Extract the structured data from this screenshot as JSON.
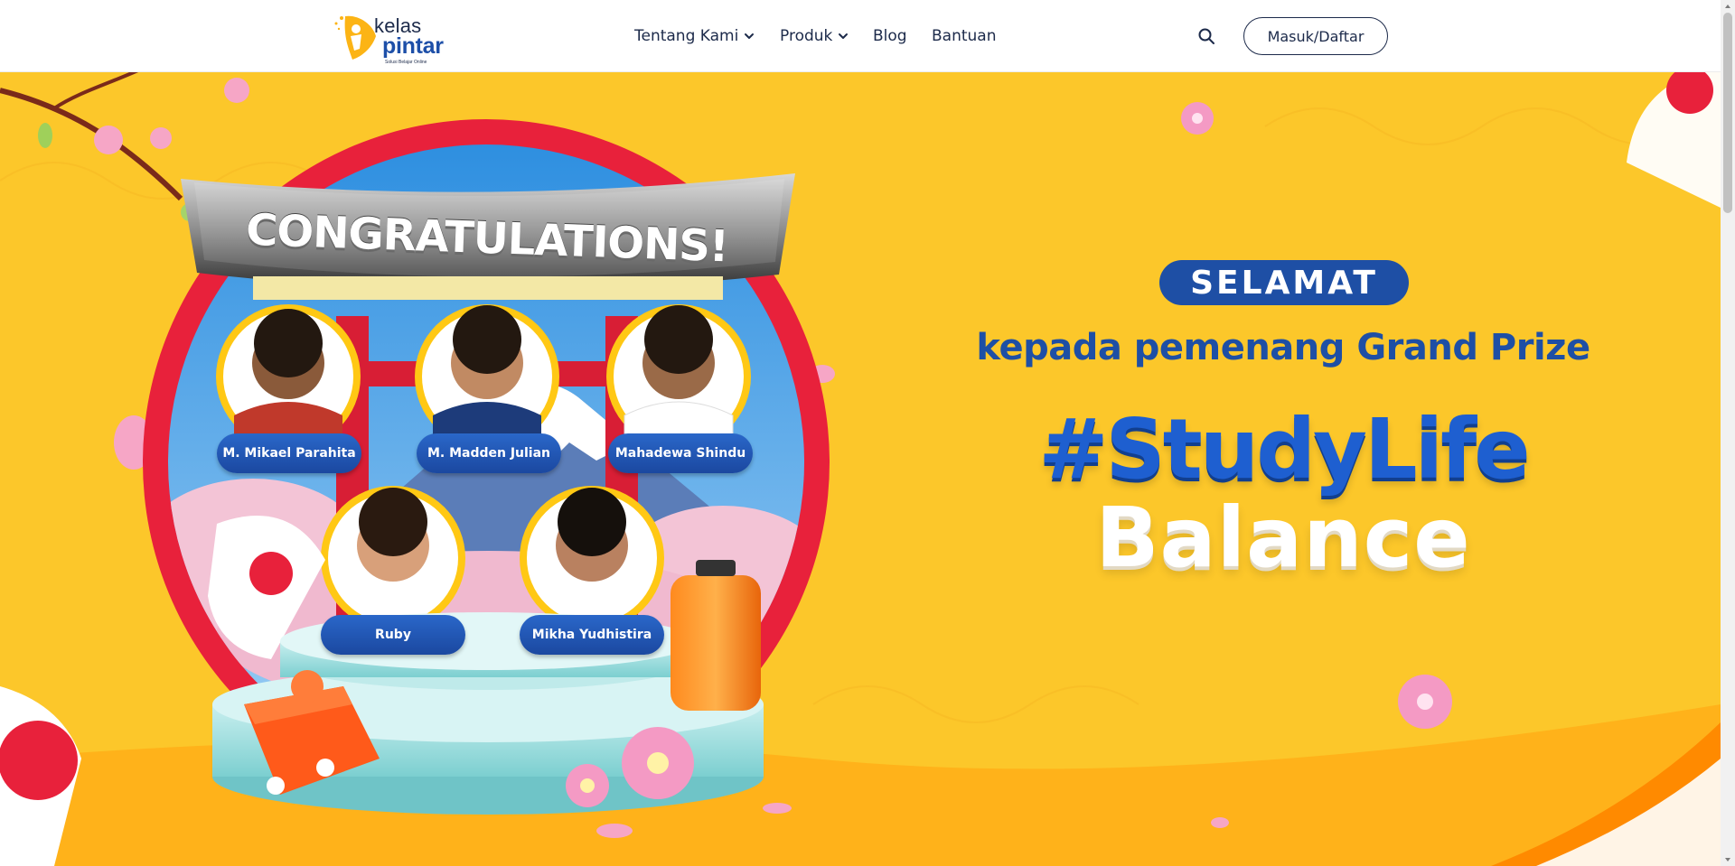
{
  "header": {
    "logo": {
      "word1": "kelas",
      "word2": "pintar",
      "tagline": "Solusi Belajar Online"
    },
    "nav": [
      {
        "label": "Tentang Kami",
        "has_dropdown": true
      },
      {
        "label": "Produk",
        "has_dropdown": true
      },
      {
        "label": "Blog",
        "has_dropdown": false
      },
      {
        "label": "Bantuan",
        "has_dropdown": false
      }
    ],
    "search_icon": "search-icon",
    "login_label": "Masuk/Daftar"
  },
  "banner": {
    "congrats": "CONGRATULATIONS!",
    "winners": [
      "M. Mikael Parahita",
      "M. Madden Julian",
      "Mahadewa Shindu",
      "Ruby",
      "Mikha Yudhistira"
    ],
    "selamat": "SELAMAT",
    "subtitle": "kepada pemenang Grand Prize",
    "campaign_line1": "#StudyLife",
    "campaign_line2": "Balance"
  },
  "colors": {
    "banner_bg": "#fcc72a",
    "brand_blue": "#1e4fa5",
    "torii_red": "#e8213b",
    "nav_text": "#1c2a4a"
  }
}
